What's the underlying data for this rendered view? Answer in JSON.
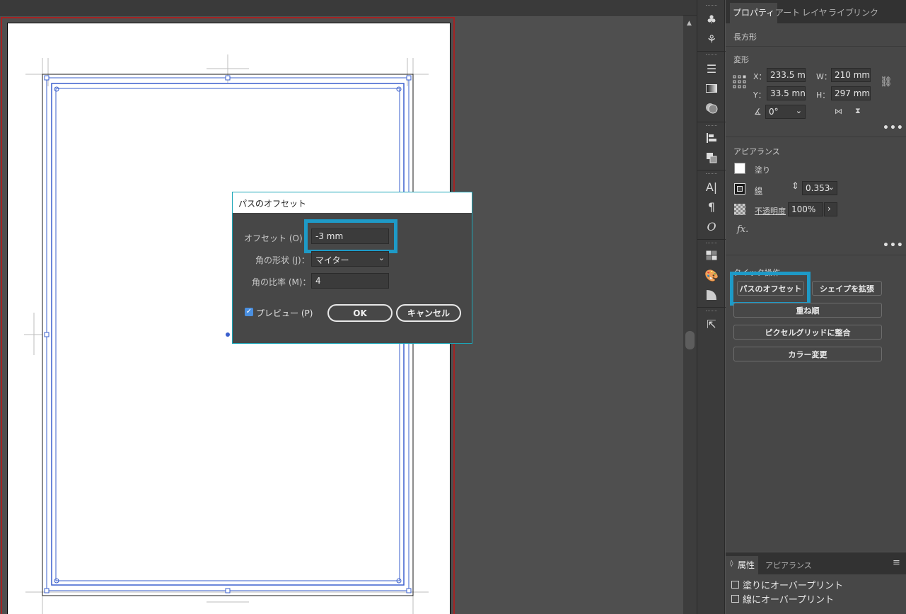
{
  "properties_panel": {
    "tabs": [
      "プロパティ",
      "アート",
      "レイヤ",
      "ライブ",
      "リンク"
    ],
    "object_type": "長方形",
    "transform": {
      "title": "変形",
      "x_label": "X：",
      "x_value": "233.5 m",
      "y_label": "Y：",
      "y_value": "33.5 mn",
      "w_label": "W：",
      "w_value": "210 mm",
      "h_label": "H：",
      "h_value": "297 mm",
      "angle_value": "0°"
    },
    "appearance": {
      "title": "アピアランス",
      "fill_label": "塗り",
      "stroke_label": "線",
      "stroke_value": "0.353",
      "opacity_label": "不透明度",
      "opacity_value": "100%",
      "fx_label": "fx."
    },
    "quick_actions": {
      "title": "クイック操作",
      "offset_path": "パスのオフセット",
      "expand_shape": "シェイプを拡張",
      "arrange": "重ね順",
      "align_pixel_grid": "ピクセルグリッドに整合",
      "recolor": "カラー変更"
    },
    "more": "•••"
  },
  "attributes_panel": {
    "tabs": [
      "属性",
      "アピアランス"
    ],
    "overprint_fill": "塗りにオーバープリント",
    "overprint_stroke": "線にオーバープリント"
  },
  "dialog": {
    "title": "パスのオフセット",
    "offset_label": "オフセット (O)",
    "offset_value": "-3 mm",
    "joins_label": "角の形状 (J)：",
    "joins_value": "マイター",
    "miter_label": "角の比率 (M)：",
    "miter_value": "4",
    "preview_label": "プレビュー (P)",
    "preview_checked": true,
    "ok_label": "OK",
    "cancel_label": "キャンセル"
  },
  "colors": {
    "highlight": "#1e9ac7",
    "bleed": "#a42323",
    "selection": "#3a5fcd"
  }
}
